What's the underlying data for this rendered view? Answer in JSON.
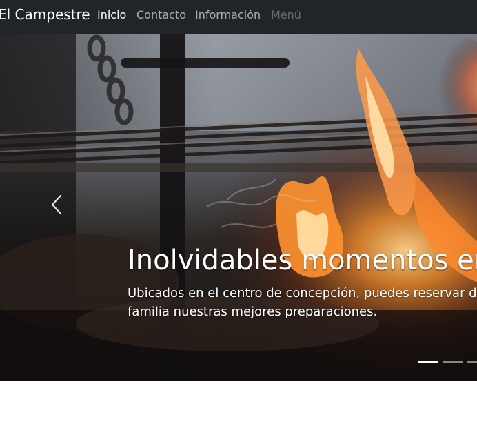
{
  "navbar": {
    "brand": "El Campestre",
    "links": [
      {
        "label": "Inicio",
        "state": "active"
      },
      {
        "label": "Contacto",
        "state": "normal"
      },
      {
        "label": "Información",
        "state": "normal"
      },
      {
        "label": "Menú",
        "state": "disabled"
      }
    ],
    "background_color": "#212529"
  },
  "carousel": {
    "slide": {
      "image": "grill-fire-photo",
      "title": "Inolvidables momentos en",
      "text": "Ubicados en el centro de concepción, puedes reservar disfrutar en familia nuestras mejores preparaciones."
    },
    "controls": {
      "prev_icon": "chevron-left-icon"
    },
    "indicators": {
      "count": 3,
      "active_index": 0
    }
  }
}
